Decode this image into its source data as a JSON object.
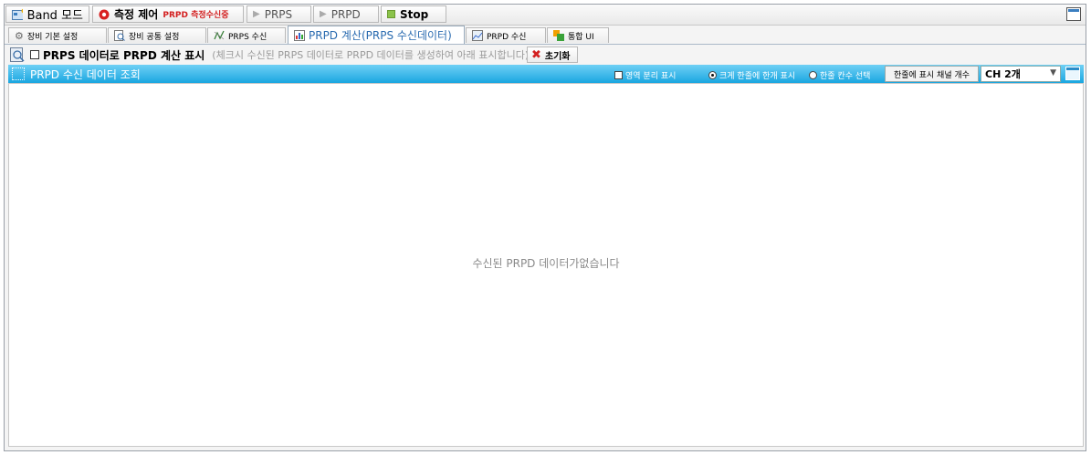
{
  "toolbar": {
    "band_mode": "Band 모드",
    "measure_control": "측정 제어",
    "measure_status": "PRPD 측정수신중",
    "prps": "PRPS",
    "prpd": "PRPD",
    "stop": "Stop"
  },
  "tabs": [
    {
      "label": "장비 기본 설정",
      "icon": "gear-icon"
    },
    {
      "label": "장비 공통 설정",
      "icon": "search-doc-icon"
    },
    {
      "label": "PRPS 수신",
      "icon": "signal-icon"
    },
    {
      "label": "PRPD 계산(PRPS 수신데이터)",
      "icon": "chart-icon",
      "active": true
    },
    {
      "label": "PRPD 수신",
      "icon": "image-icon"
    },
    {
      "label": "통합 UI",
      "icon": "windows-icon"
    }
  ],
  "options": {
    "calc_label": "PRPS 데이터로 PRPD 계산 표시",
    "calc_hint": "(체크시 수신된 PRPS 데이터로 PRPD 데이터를 생성하여 아래 표시합니다)",
    "reset": "초기화"
  },
  "header": {
    "title": "PRPD 수신 데이터 조회",
    "region_split": "영역 분리 표시",
    "large_one": "크게 한줄에 한개 표시",
    "select_count": "한줄 칸수 선택",
    "channels_per_row": "한줄에 표시 채널 개수",
    "channel_value": "CH 2개"
  },
  "content": {
    "empty": "수신된 PRPD 데이터가없습니다"
  },
  "colors": {
    "header_start": "#6fd0f5",
    "header_end": "#1aa6e0",
    "status_red": "#d32020",
    "active_tab": "#2a6bb0"
  }
}
